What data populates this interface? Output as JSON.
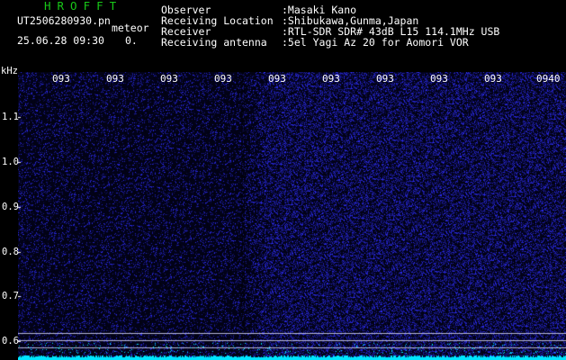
{
  "header": {
    "brand": "HROFFT",
    "filename": "UT2506280930.pn",
    "mode": "meteor",
    "datetime": "25.06.28 09:30",
    "count": "0."
  },
  "info": [
    {
      "label": "Observer",
      "value": ":Masaki Kano"
    },
    {
      "label": "Receiving Location",
      "value": ":Shibukawa,Gunma,Japan"
    },
    {
      "label": "Receiver",
      "value": ":RTL-SDR SDR# 43dB L15 114.1MHz USB"
    },
    {
      "label": "Receiving antenna",
      "value": ":5el Yagi Az 20 for Aomori VOR"
    }
  ],
  "y_axis": {
    "unit": "kHz",
    "ticks": [
      "1.1",
      "1.0",
      "0.9",
      "0.8",
      "0.7",
      "0.6"
    ]
  },
  "x_axis": {
    "ticks": [
      "093",
      "093",
      "093",
      "093",
      "093",
      "093",
      "093",
      "093",
      "093",
      "0940"
    ]
  },
  "colors": {
    "background": "#000000",
    "noise": "#2a2aff",
    "signal_band": "#00e5ff",
    "brand_green": "#18c818",
    "text": "#ffffff"
  }
}
